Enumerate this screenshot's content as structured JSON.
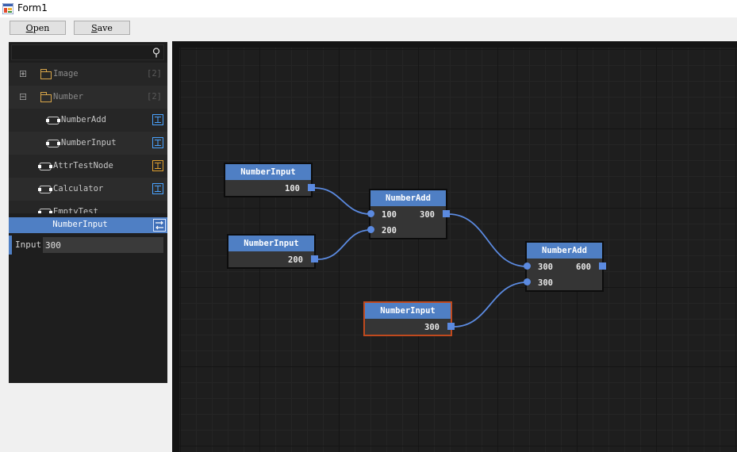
{
  "window": {
    "title": "Form1"
  },
  "toolbar": {
    "open": {
      "accel": "O",
      "rest": "pen"
    },
    "save": {
      "accel": "S",
      "rest": "ave"
    }
  },
  "tree": {
    "search": {
      "value": "",
      "placeholder": ""
    },
    "folders": [
      {
        "label": "Image",
        "count": "[2]",
        "expanded": false
      },
      {
        "label": "Number",
        "count": "[2]",
        "expanded": true
      }
    ],
    "items": [
      {
        "label": "NumberAdd",
        "badge_color": "#4aa3ff"
      },
      {
        "label": "NumberInput",
        "badge_color": "#4aa3ff"
      },
      {
        "label": "AttrTestNode",
        "badge_color": "#e0a030"
      },
      {
        "label": "Calculator",
        "badge_color": "#4aa3ff"
      },
      {
        "label": "EmptyTest",
        "badge_color": "#4aa3ff"
      }
    ]
  },
  "properties": {
    "title": "NumberInput",
    "fields": [
      {
        "label": "Input",
        "value": "300"
      }
    ]
  },
  "graph": {
    "nodes": [
      {
        "id": "n1",
        "title": "NumberInput",
        "outputs": [
          "100"
        ],
        "inputs": []
      },
      {
        "id": "n2",
        "title": "NumberInput",
        "outputs": [
          "200"
        ],
        "inputs": []
      },
      {
        "id": "n3",
        "title": "NumberAdd",
        "inputs": [
          "100",
          "200"
        ],
        "outputs": [
          "300"
        ]
      },
      {
        "id": "n4",
        "title": "NumberAdd",
        "inputs": [
          "300",
          "300"
        ],
        "outputs": [
          "600"
        ]
      },
      {
        "id": "n5",
        "title": "NumberInput",
        "outputs": [
          "300"
        ],
        "inputs": [],
        "selected": true
      }
    ]
  },
  "colors": {
    "accent": "#4f7fc4",
    "port": "#5b8ae0",
    "selection": "#c04a1e",
    "canvas": "#1e1e1e"
  }
}
